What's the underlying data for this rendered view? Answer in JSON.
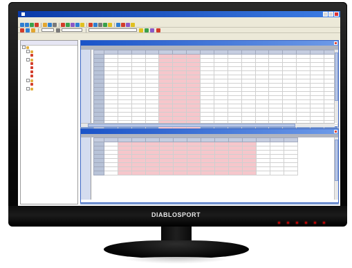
{
  "brand": {
    "logo_text": "DIABLOSPORT"
  },
  "app": {
    "title": "",
    "menus": [],
    "toolbar_fields": {
      "field1": "",
      "field2": "",
      "field3": ""
    }
  },
  "navigator": {
    "items": [
      {
        "label": "",
        "level": 0,
        "icon": "folder-icon"
      },
      {
        "label": "",
        "level": 1,
        "icon": "folder-icon"
      },
      {
        "label": "",
        "level": 2,
        "icon": "map-icon"
      },
      {
        "label": "",
        "level": 1,
        "icon": "folder-icon"
      },
      {
        "label": "",
        "level": 2,
        "icon": "map-icon"
      },
      {
        "label": "",
        "level": 2,
        "icon": "map-icon"
      },
      {
        "label": "",
        "level": 2,
        "icon": "map-icon"
      },
      {
        "label": "",
        "level": 2,
        "icon": "map-icon"
      },
      {
        "label": "",
        "level": 1,
        "icon": "folder-icon"
      },
      {
        "label": "",
        "level": 2,
        "icon": "map-icon"
      },
      {
        "label": "",
        "level": 1,
        "icon": "folder-icon"
      }
    ]
  },
  "windows": {
    "top": {
      "title": "",
      "tab": ""
    },
    "bottom": {
      "title": "",
      "tab": ""
    }
  },
  "colors": {
    "highlight": "#f6c6cb",
    "title_bar": "#1a53c8",
    "workspace": "#7b9ad0"
  }
}
